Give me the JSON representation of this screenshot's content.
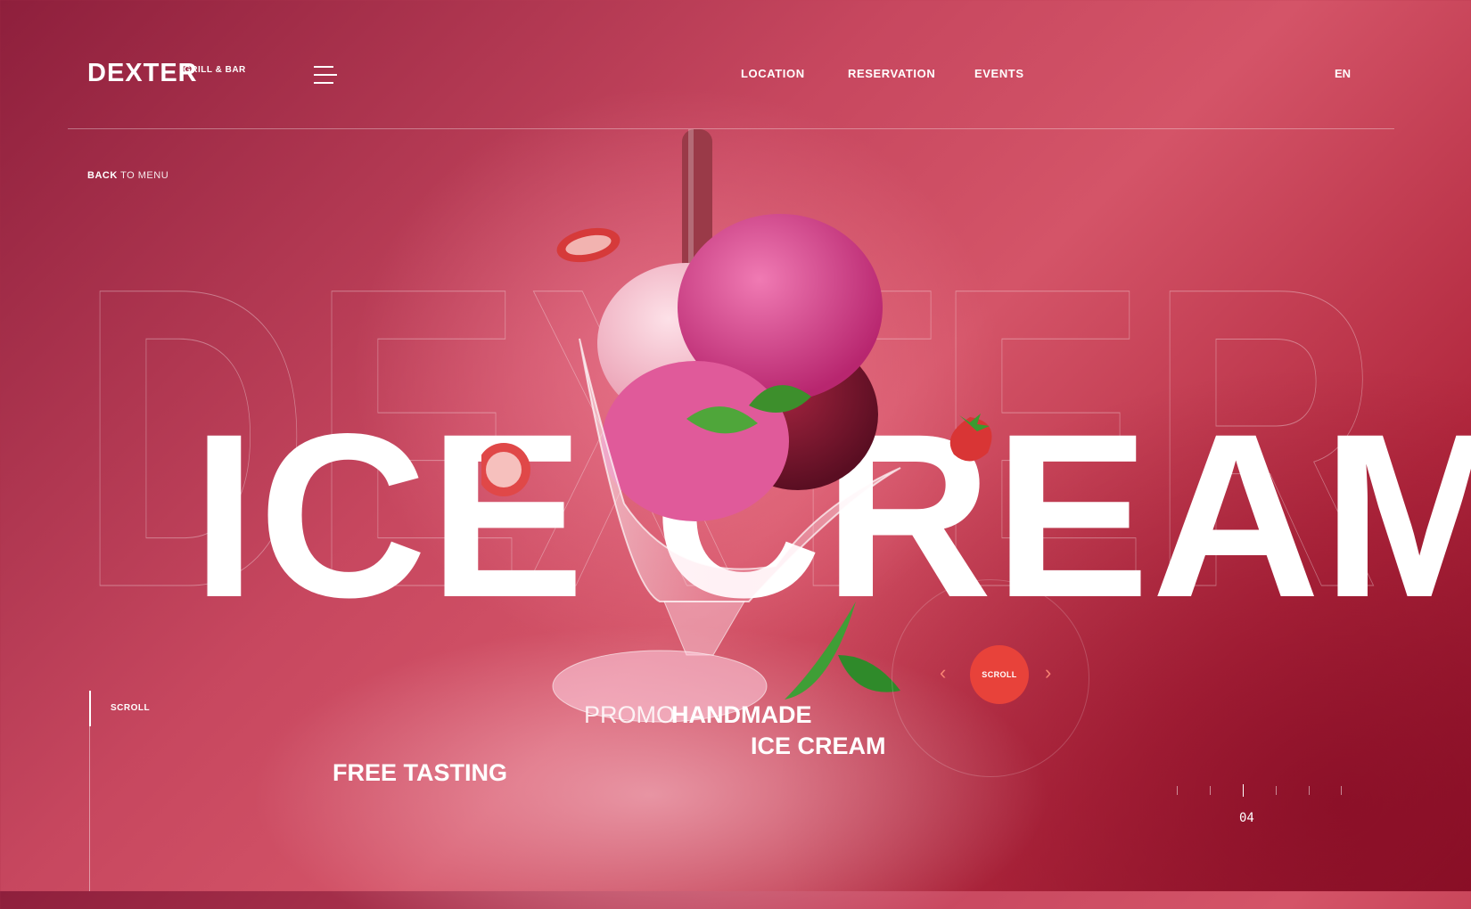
{
  "header": {
    "brand": "DEXTER",
    "brand_sub": "GRILL & BAR",
    "nav": [
      "LOCATION",
      "RESERVATION",
      "EVENTS"
    ],
    "lang": "EN"
  },
  "back": {
    "bold": "BACK",
    "rest": "TO MENU"
  },
  "background_word": "DEXTER",
  "hero": {
    "title": "ICE CREAM"
  },
  "promo": {
    "label": "PROMO",
    "line1": "HANDMADE",
    "line2": "ICE CREAM",
    "free": "FREE TASTING"
  },
  "scroll": {
    "side_label": "SCROLL",
    "button_label": "SCROLL"
  },
  "pager": {
    "current": "04"
  },
  "icons": [
    "hamburger-menu-icon",
    "chevron-left-icon",
    "chevron-right-icon"
  ],
  "colors": {
    "accent": "#e8423a",
    "background": "#c7475f"
  }
}
